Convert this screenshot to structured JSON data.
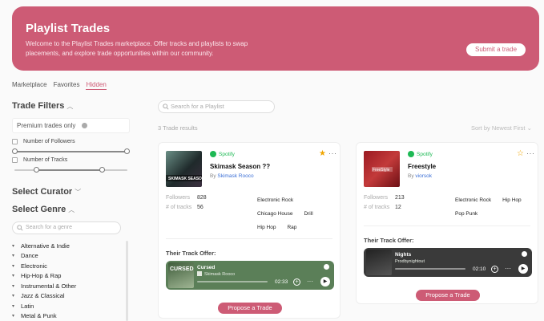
{
  "hero": {
    "title": "Playlist Trades",
    "description": "Welcome to the Playlist Trades marketplace. Offer tracks and playlists to swap placements, and explore trade opportunities within our community.",
    "submit_label": "Submit a trade"
  },
  "tabs": [
    "Marketplace",
    "Favorites",
    "Hidden"
  ],
  "filters": {
    "title": "Trade Filters",
    "premium_label": "Premium trades only",
    "followers_label": "Number of Followers",
    "tracks_label": "Number of Tracks",
    "curator_title": "Select Curator",
    "genre_title": "Select Genre",
    "genre_search_placeholder": "Search for a genre",
    "genres": [
      "Alternative & Indie",
      "Dance",
      "Electronic",
      "Hip-Hop & Rap",
      "Instrumental & Other",
      "Jazz & Classical",
      "Latin",
      "Metal & Punk"
    ]
  },
  "main": {
    "search_placeholder": "Search for a Playlist",
    "results": "3 Trade results",
    "sort": "Sort by Newest First"
  },
  "labels": {
    "followers": "Followers",
    "tracks": "# of tracks",
    "offer": "Their Track Offer:",
    "propose": "Propose a Trade",
    "spotify": "Spotify",
    "by": "By"
  },
  "cards": [
    {
      "name": "Skimask Season ??",
      "curator": "Skimask Rooco",
      "followers": "828",
      "tracks": "56",
      "tags": [
        "Electronic Rock",
        "Chicago House",
        "Drill",
        "Hip Hop",
        "Rap"
      ],
      "favorited": true,
      "track": {
        "title": "Cursed",
        "artist": "Skimask Rooco",
        "time": "02:33",
        "color": "#5b7f58"
      }
    },
    {
      "name": "Freestyle",
      "curator": "viorsok",
      "followers": "213",
      "tracks": "12",
      "tags": [
        "Electronic Rock",
        "Hip Hop",
        "Pop Punk"
      ],
      "favorited": false,
      "track": {
        "title": "Nights",
        "artist": "Prodbynightout",
        "time": "02:10",
        "color": "#3a3a3a"
      }
    }
  ],
  "colors": {
    "accent": "#cd5b75",
    "spotify": "#1db954",
    "star": "#f0a500"
  }
}
